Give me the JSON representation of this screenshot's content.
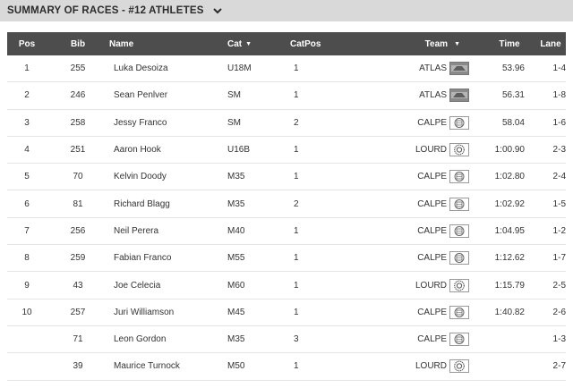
{
  "header": {
    "title": "SUMMARY OF RACES - #12 ATHLETES"
  },
  "columns": {
    "pos": "Pos",
    "bib": "Bib",
    "name": "Name",
    "cat": "Cat",
    "catpos": "CatPos",
    "team": "Team",
    "time": "Time",
    "lane": "Lane"
  },
  "rows": [
    {
      "pos": "1",
      "bib": "255",
      "name": "Luka Desoiza",
      "cat": "U18M",
      "catpos": "1",
      "team": "ATLAS",
      "logo": "atlas-crest-icon",
      "time": "53.96",
      "lane": "1-4"
    },
    {
      "pos": "2",
      "bib": "246",
      "name": "Sean Penlver",
      "cat": "SM",
      "catpos": "1",
      "team": "ATLAS",
      "logo": "atlas-crest-icon",
      "time": "56.31",
      "lane": "1-8"
    },
    {
      "pos": "3",
      "bib": "258",
      "name": "Jessy Franco",
      "cat": "SM",
      "catpos": "2",
      "team": "CALPE",
      "logo": "calpe-crest-icon",
      "time": "58.04",
      "lane": "1-6"
    },
    {
      "pos": "4",
      "bib": "251",
      "name": "Aaron Hook",
      "cat": "U16B",
      "catpos": "1",
      "team": "LOURD",
      "logo": "lourd-crest-icon",
      "time": "1:00.90",
      "lane": "2-3"
    },
    {
      "pos": "5",
      "bib": "70",
      "name": "Kelvin Doody",
      "cat": "M35",
      "catpos": "1",
      "team": "CALPE",
      "logo": "calpe-crest-icon",
      "time": "1:02.80",
      "lane": "2-4"
    },
    {
      "pos": "6",
      "bib": "81",
      "name": "Richard Blagg",
      "cat": "M35",
      "catpos": "2",
      "team": "CALPE",
      "logo": "calpe-crest-icon",
      "time": "1:02.92",
      "lane": "1-5"
    },
    {
      "pos": "7",
      "bib": "256",
      "name": "Neil Perera",
      "cat": "M40",
      "catpos": "1",
      "team": "CALPE",
      "logo": "calpe-crest-icon",
      "time": "1:04.95",
      "lane": "1-2"
    },
    {
      "pos": "8",
      "bib": "259",
      "name": "Fabian Franco",
      "cat": "M55",
      "catpos": "1",
      "team": "CALPE",
      "logo": "calpe-crest-icon",
      "time": "1:12.62",
      "lane": "1-7"
    },
    {
      "pos": "9",
      "bib": "43",
      "name": "Joe Celecia",
      "cat": "M60",
      "catpos": "1",
      "team": "LOURD",
      "logo": "lourd-crest-icon",
      "time": "1:15.79",
      "lane": "2-5"
    },
    {
      "pos": "10",
      "bib": "257",
      "name": "Juri Williamson",
      "cat": "M45",
      "catpos": "1",
      "team": "CALPE",
      "logo": "calpe-crest-icon",
      "time": "1:40.82",
      "lane": "2-6"
    },
    {
      "pos": "",
      "bib": "71",
      "name": "Leon Gordon",
      "cat": "M35",
      "catpos": "3",
      "team": "CALPE",
      "logo": "calpe-crest-icon",
      "time": "",
      "lane": "1-3"
    },
    {
      "pos": "",
      "bib": "39",
      "name": "Maurice Turnock",
      "cat": "M50",
      "catpos": "1",
      "team": "LOURD",
      "logo": "lourd-crest-icon",
      "time": "",
      "lane": "2-7"
    }
  ]
}
